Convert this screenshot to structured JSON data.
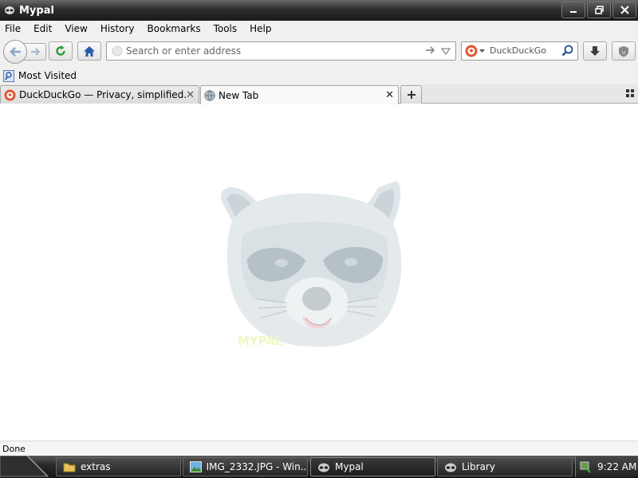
{
  "window": {
    "title": "Mypal"
  },
  "menu": [
    "File",
    "Edit",
    "View",
    "History",
    "Bookmarks",
    "Tools",
    "Help"
  ],
  "navbar": {
    "url_placeholder": "Search or enter address",
    "search_engine": "DuckDuckGo"
  },
  "bookmarks": {
    "most_visited": "Most Visited"
  },
  "tabs": [
    {
      "label": "DuckDuckGo — Privacy, simplified."
    },
    {
      "label": "New Tab"
    }
  ],
  "content": {
    "logo_text": "MYPAL"
  },
  "status": {
    "text": "Done"
  },
  "taskbar": {
    "items": [
      {
        "label": "extras"
      },
      {
        "label": "IMG_2332.JPG - Win..."
      },
      {
        "label": "Mypal"
      },
      {
        "label": "Library"
      }
    ],
    "clock": "9:22 AM"
  },
  "colors": {
    "accent_arrow": "#2a6fc9",
    "reload": "#2e9a2e",
    "ddg_orange": "#de5833"
  }
}
